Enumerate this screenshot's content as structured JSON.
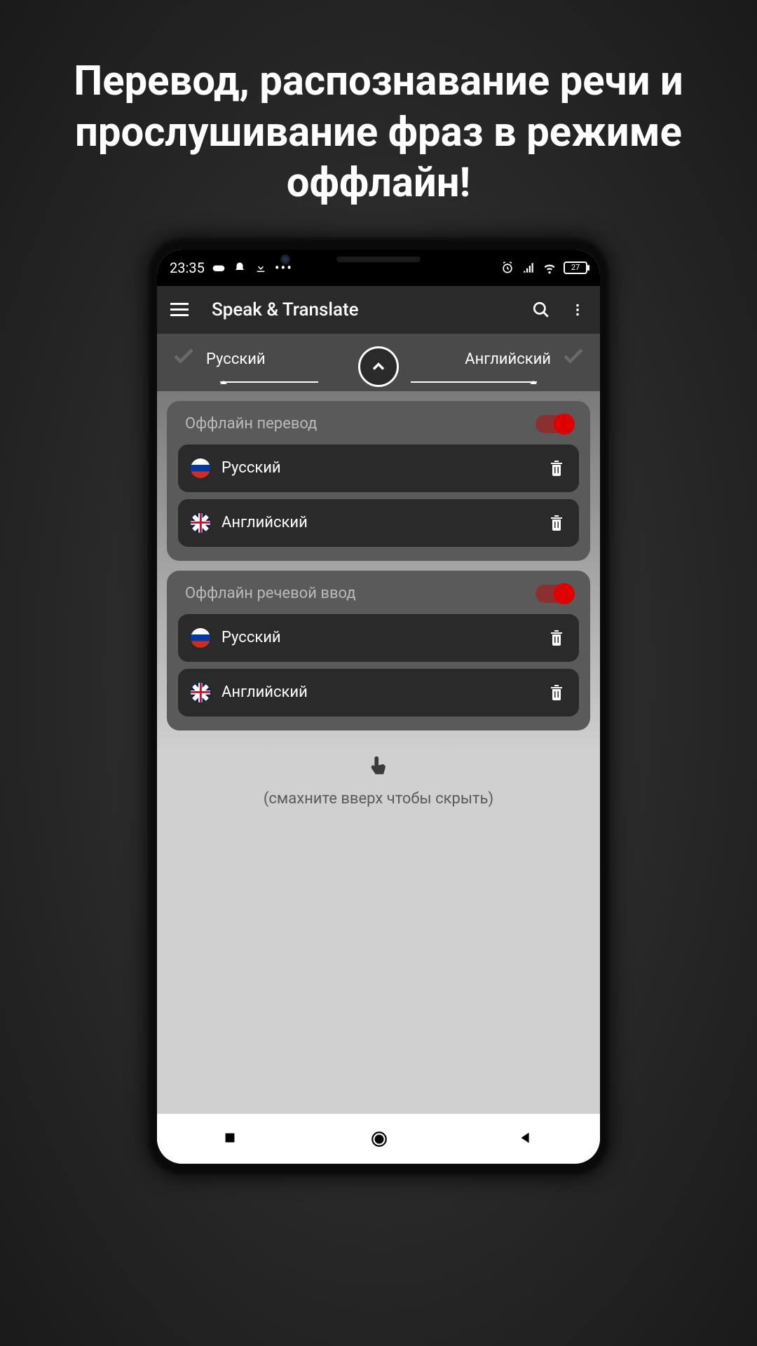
{
  "promo": {
    "headline": "Перевод, распознавание речи и прослушивание фраз в режиме оффлайн!"
  },
  "status": {
    "time": "23:35",
    "battery": "27"
  },
  "appbar": {
    "title": "Speak & Translate"
  },
  "selector": {
    "source": "Русский",
    "target": "Английский"
  },
  "sections": [
    {
      "title": "Оффлайн перевод",
      "enabled": true,
      "langs": [
        {
          "name": "Русский",
          "flag": "ru"
        },
        {
          "name": "Английский",
          "flag": "uk"
        }
      ]
    },
    {
      "title": "Оффлайн речевой ввод",
      "enabled": true,
      "langs": [
        {
          "name": "Русский",
          "flag": "ru"
        },
        {
          "name": "Английский",
          "flag": "uk"
        }
      ]
    }
  ],
  "hint": "(смахните вверх чтобы скрыть)"
}
